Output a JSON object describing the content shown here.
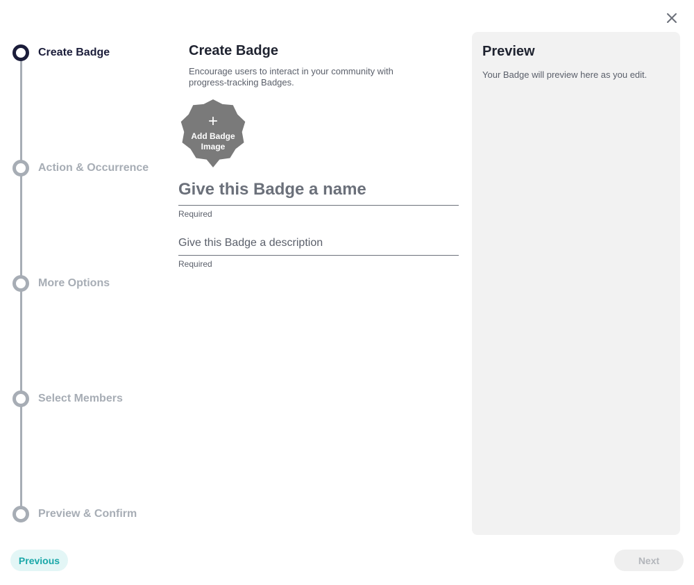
{
  "close": {
    "icon": "close-icon"
  },
  "stepper": {
    "steps": [
      {
        "label": "Create Badge",
        "active": true
      },
      {
        "label": "Action & Occurrence",
        "active": false
      },
      {
        "label": "More Options",
        "active": false
      },
      {
        "label": "Select Members",
        "active": false
      },
      {
        "label": "Preview & Confirm",
        "active": false
      }
    ]
  },
  "form": {
    "title": "Create Badge",
    "subtitle": "Encourage users to interact in your community with progress-tracking Badges.",
    "badge_image": {
      "icon": "plus-icon",
      "label": "Add Badge Image",
      "plus": "+"
    },
    "name_field": {
      "placeholder": "Give this Badge a name",
      "value": "",
      "hint": "Required"
    },
    "description_field": {
      "placeholder": "Give this Badge a description",
      "value": "",
      "hint": "Required"
    }
  },
  "preview": {
    "title": "Preview",
    "text": "Your Badge will preview here as you edit."
  },
  "footer": {
    "previous_label": "Previous",
    "next_label": "Next"
  },
  "colors": {
    "active_step": "#1b1d3a",
    "inactive_step": "#a7adb5",
    "accent": "#19a7a8",
    "badge_fill": "#7a7a7a",
    "preview_bg": "#f2f2f2"
  }
}
